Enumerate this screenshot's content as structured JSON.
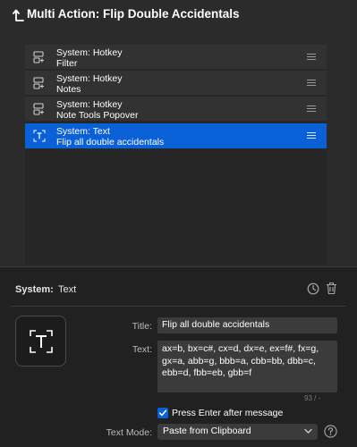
{
  "header": {
    "title": "Multi Action: Flip Double Accidentals"
  },
  "actions": [
    {
      "type": "System: Hotkey",
      "name": "Filter",
      "icon": "hotkey-icon",
      "selected": false
    },
    {
      "type": "System: Hotkey",
      "name": "Notes",
      "icon": "hotkey-icon",
      "selected": false
    },
    {
      "type": "System: Hotkey",
      "name": "Note Tools Popover",
      "icon": "hotkey-icon",
      "selected": false
    },
    {
      "type": "System: Text",
      "name": "Flip all double accidentals",
      "icon": "text-icon",
      "selected": true
    }
  ],
  "detail": {
    "system_label": "System:",
    "system_value": "Text",
    "title_label": "Title:",
    "title_value": "Flip all double accidentals",
    "text_label": "Text:",
    "text_value": "ax=b, bx=c#, cx=d, dx=e, ex=f#, fx=g, gx=a, abb=g, bbb=a, cbb=bb, dbb=c, ebb=d, fbb=eb, gbb=f",
    "char_count": "93 / -",
    "press_enter_label": "Press Enter after message",
    "press_enter_checked": true,
    "text_mode_label": "Text Mode:",
    "text_mode_value": "Paste from Clipboard"
  },
  "colors": {
    "accent": "#0a60d6",
    "background": "#2b2b2b",
    "panel": "#212121"
  }
}
